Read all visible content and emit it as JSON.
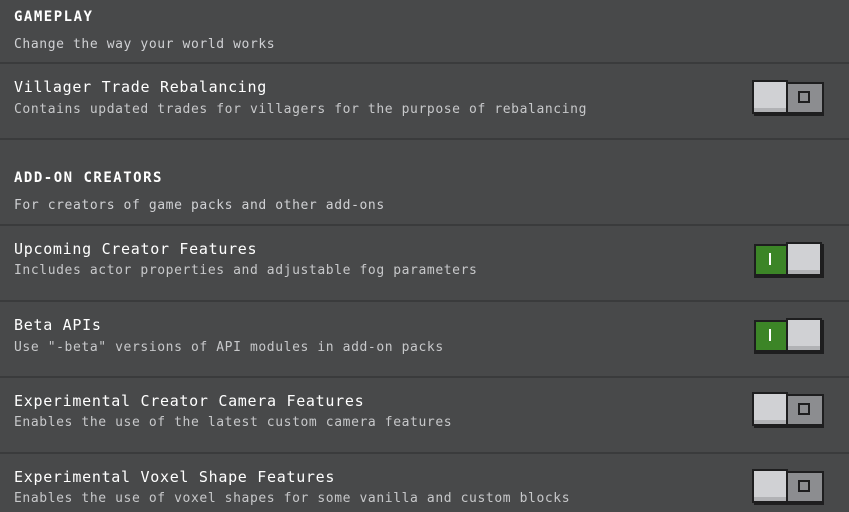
{
  "gameplay": {
    "title": "GAMEPLAY",
    "description": "Change the way your world works",
    "items": [
      {
        "title": "Villager Trade Rebalancing",
        "description": "Contains updated trades for villagers for the purpose of rebalancing",
        "enabled": false
      }
    ]
  },
  "addon_creators": {
    "title": "ADD-ON CREATORS",
    "description": "For creators of game packs and other add-ons",
    "items": [
      {
        "title": "Upcoming Creator Features",
        "description": "Includes actor properties and adjustable fog parameters",
        "enabled": true
      },
      {
        "title": "Beta APIs",
        "description": "Use \"-beta\" versions of API modules in add-on packs",
        "enabled": true
      },
      {
        "title": "Experimental Creator Camera Features",
        "description": "Enables the use of the latest custom camera features",
        "enabled": false
      },
      {
        "title": "Experimental Voxel Shape Features",
        "description": "Enables the use of voxel shapes for some vanilla and custom blocks",
        "enabled": false
      }
    ]
  },
  "colors": {
    "background": "#48494a",
    "divider": "#3a3b3c",
    "toggle_on": "#3c8527",
    "toggle_off": "#8c8d90",
    "knob": "#d0d1d4"
  }
}
